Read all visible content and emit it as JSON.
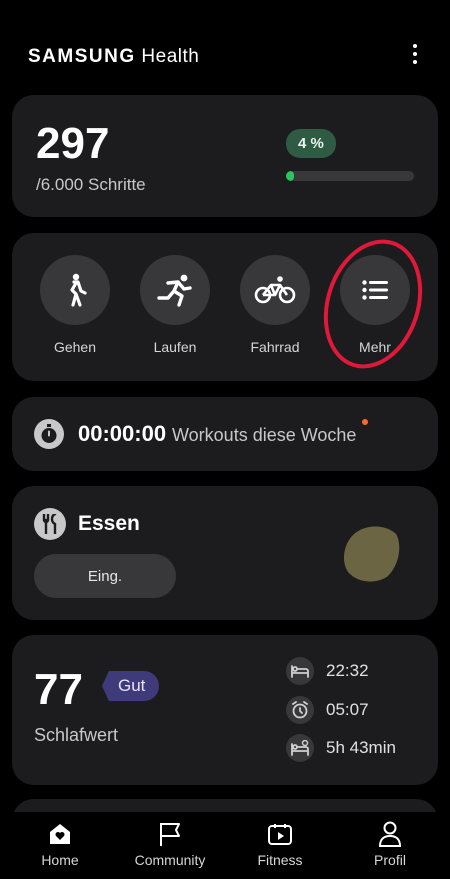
{
  "header": {
    "brand_samsung": "SAMSUNG",
    "brand_health": "Health"
  },
  "steps": {
    "value": "297",
    "goal": "/6.000 Schritte",
    "percent_label": "4 %",
    "progress_fraction": 0.04
  },
  "activities": [
    {
      "label": "Gehen",
      "icon": "walking-icon"
    },
    {
      "label": "Laufen",
      "icon": "running-icon"
    },
    {
      "label": "Fahrrad",
      "icon": "bicycle-icon"
    },
    {
      "label": "Mehr",
      "icon": "list-icon"
    }
  ],
  "workouts": {
    "time": "00:00:00",
    "text": "Workouts diese Woche"
  },
  "food": {
    "title": "Essen",
    "button": "Eing."
  },
  "sleep": {
    "score": "77",
    "rating": "Gut",
    "label": "Schlafwert",
    "bedtime": "22:32",
    "wake": "05:07",
    "duration": "5h 43min"
  },
  "nav": [
    {
      "label": "Home",
      "icon": "home-icon"
    },
    {
      "label": "Community",
      "icon": "flag-icon"
    },
    {
      "label": "Fitness",
      "icon": "fitness-play-icon"
    },
    {
      "label": "Profil",
      "icon": "profile-icon"
    }
  ],
  "colors": {
    "progress": "#29c55e",
    "annotation": "#e0193a",
    "badge_sleep": "#3f3a7a",
    "badge_steps": "#2f5b44"
  }
}
